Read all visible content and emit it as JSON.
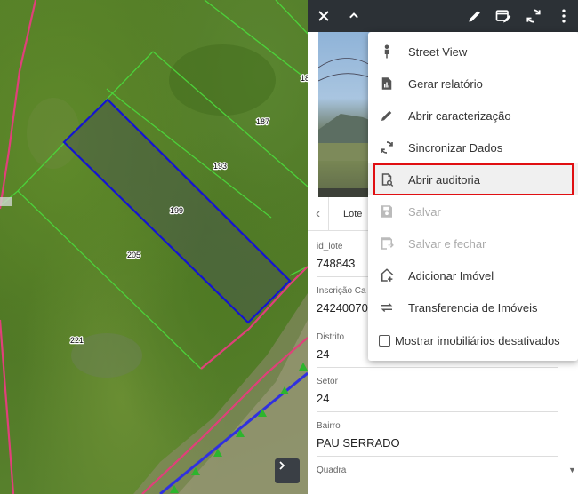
{
  "map": {
    "lots": [
      {
        "id": "lot-top-label",
        "text": "18"
      },
      {
        "id": "lot-187",
        "text": "187"
      },
      {
        "id": "lot-193",
        "text": "193"
      },
      {
        "id": "lot-199",
        "text": "199"
      },
      {
        "id": "lot-205",
        "text": "205"
      },
      {
        "id": "lot-221",
        "text": "221"
      }
    ],
    "next_button_icon": "chevron-right-icon"
  },
  "toolbar": {
    "close_icon": "close-icon",
    "collapse_icon": "chevron-up-icon",
    "edit_icon": "pencil-icon",
    "card_edit_icon": "card-edit-icon",
    "sync_icon": "sync-icon",
    "more_icon": "more-vert-icon"
  },
  "tabs": {
    "back_icon": "chevron-left-icon",
    "active_tab": "Lote"
  },
  "fields": [
    {
      "label": "id_lote",
      "value": "748843"
    },
    {
      "label": "Inscrição Ca",
      "value": "24240070"
    },
    {
      "label": "Distrito",
      "value": "24"
    },
    {
      "label": "Setor",
      "value": "24"
    },
    {
      "label": "Bairro",
      "value": "PAU SERRADO"
    },
    {
      "label": "Quadra",
      "value": ""
    }
  ],
  "menu": {
    "items": [
      {
        "label": "Street View",
        "icon": "person-icon",
        "disabled": false
      },
      {
        "label": "Gerar relatório",
        "icon": "report-icon",
        "disabled": false
      },
      {
        "label": "Abrir caracterização",
        "icon": "pencil-icon",
        "disabled": false
      },
      {
        "label": "Sincronizar Dados",
        "icon": "sync-icon",
        "disabled": false
      },
      {
        "label": "Abrir auditoria",
        "icon": "audit-icon",
        "disabled": false,
        "highlighted": true
      },
      {
        "label": "Salvar",
        "icon": "save-icon",
        "disabled": true
      },
      {
        "label": "Salvar e fechar",
        "icon": "save-close-icon",
        "disabled": true
      },
      {
        "label": "Adicionar Imóvel",
        "icon": "add-home-icon",
        "disabled": false
      },
      {
        "label": "Transferencia de Imóveis",
        "icon": "transfer-icon",
        "disabled": false
      }
    ],
    "checkbox_label": "Mostrar imobiliários desativados",
    "checkbox_checked": false
  },
  "colors": {
    "toolbar_bg": "#2c3136",
    "highlight_border": "#e00f12",
    "selected_lot": "#1414d2",
    "lot_lines": "#4cd13a",
    "road_line": "#e0407a"
  }
}
